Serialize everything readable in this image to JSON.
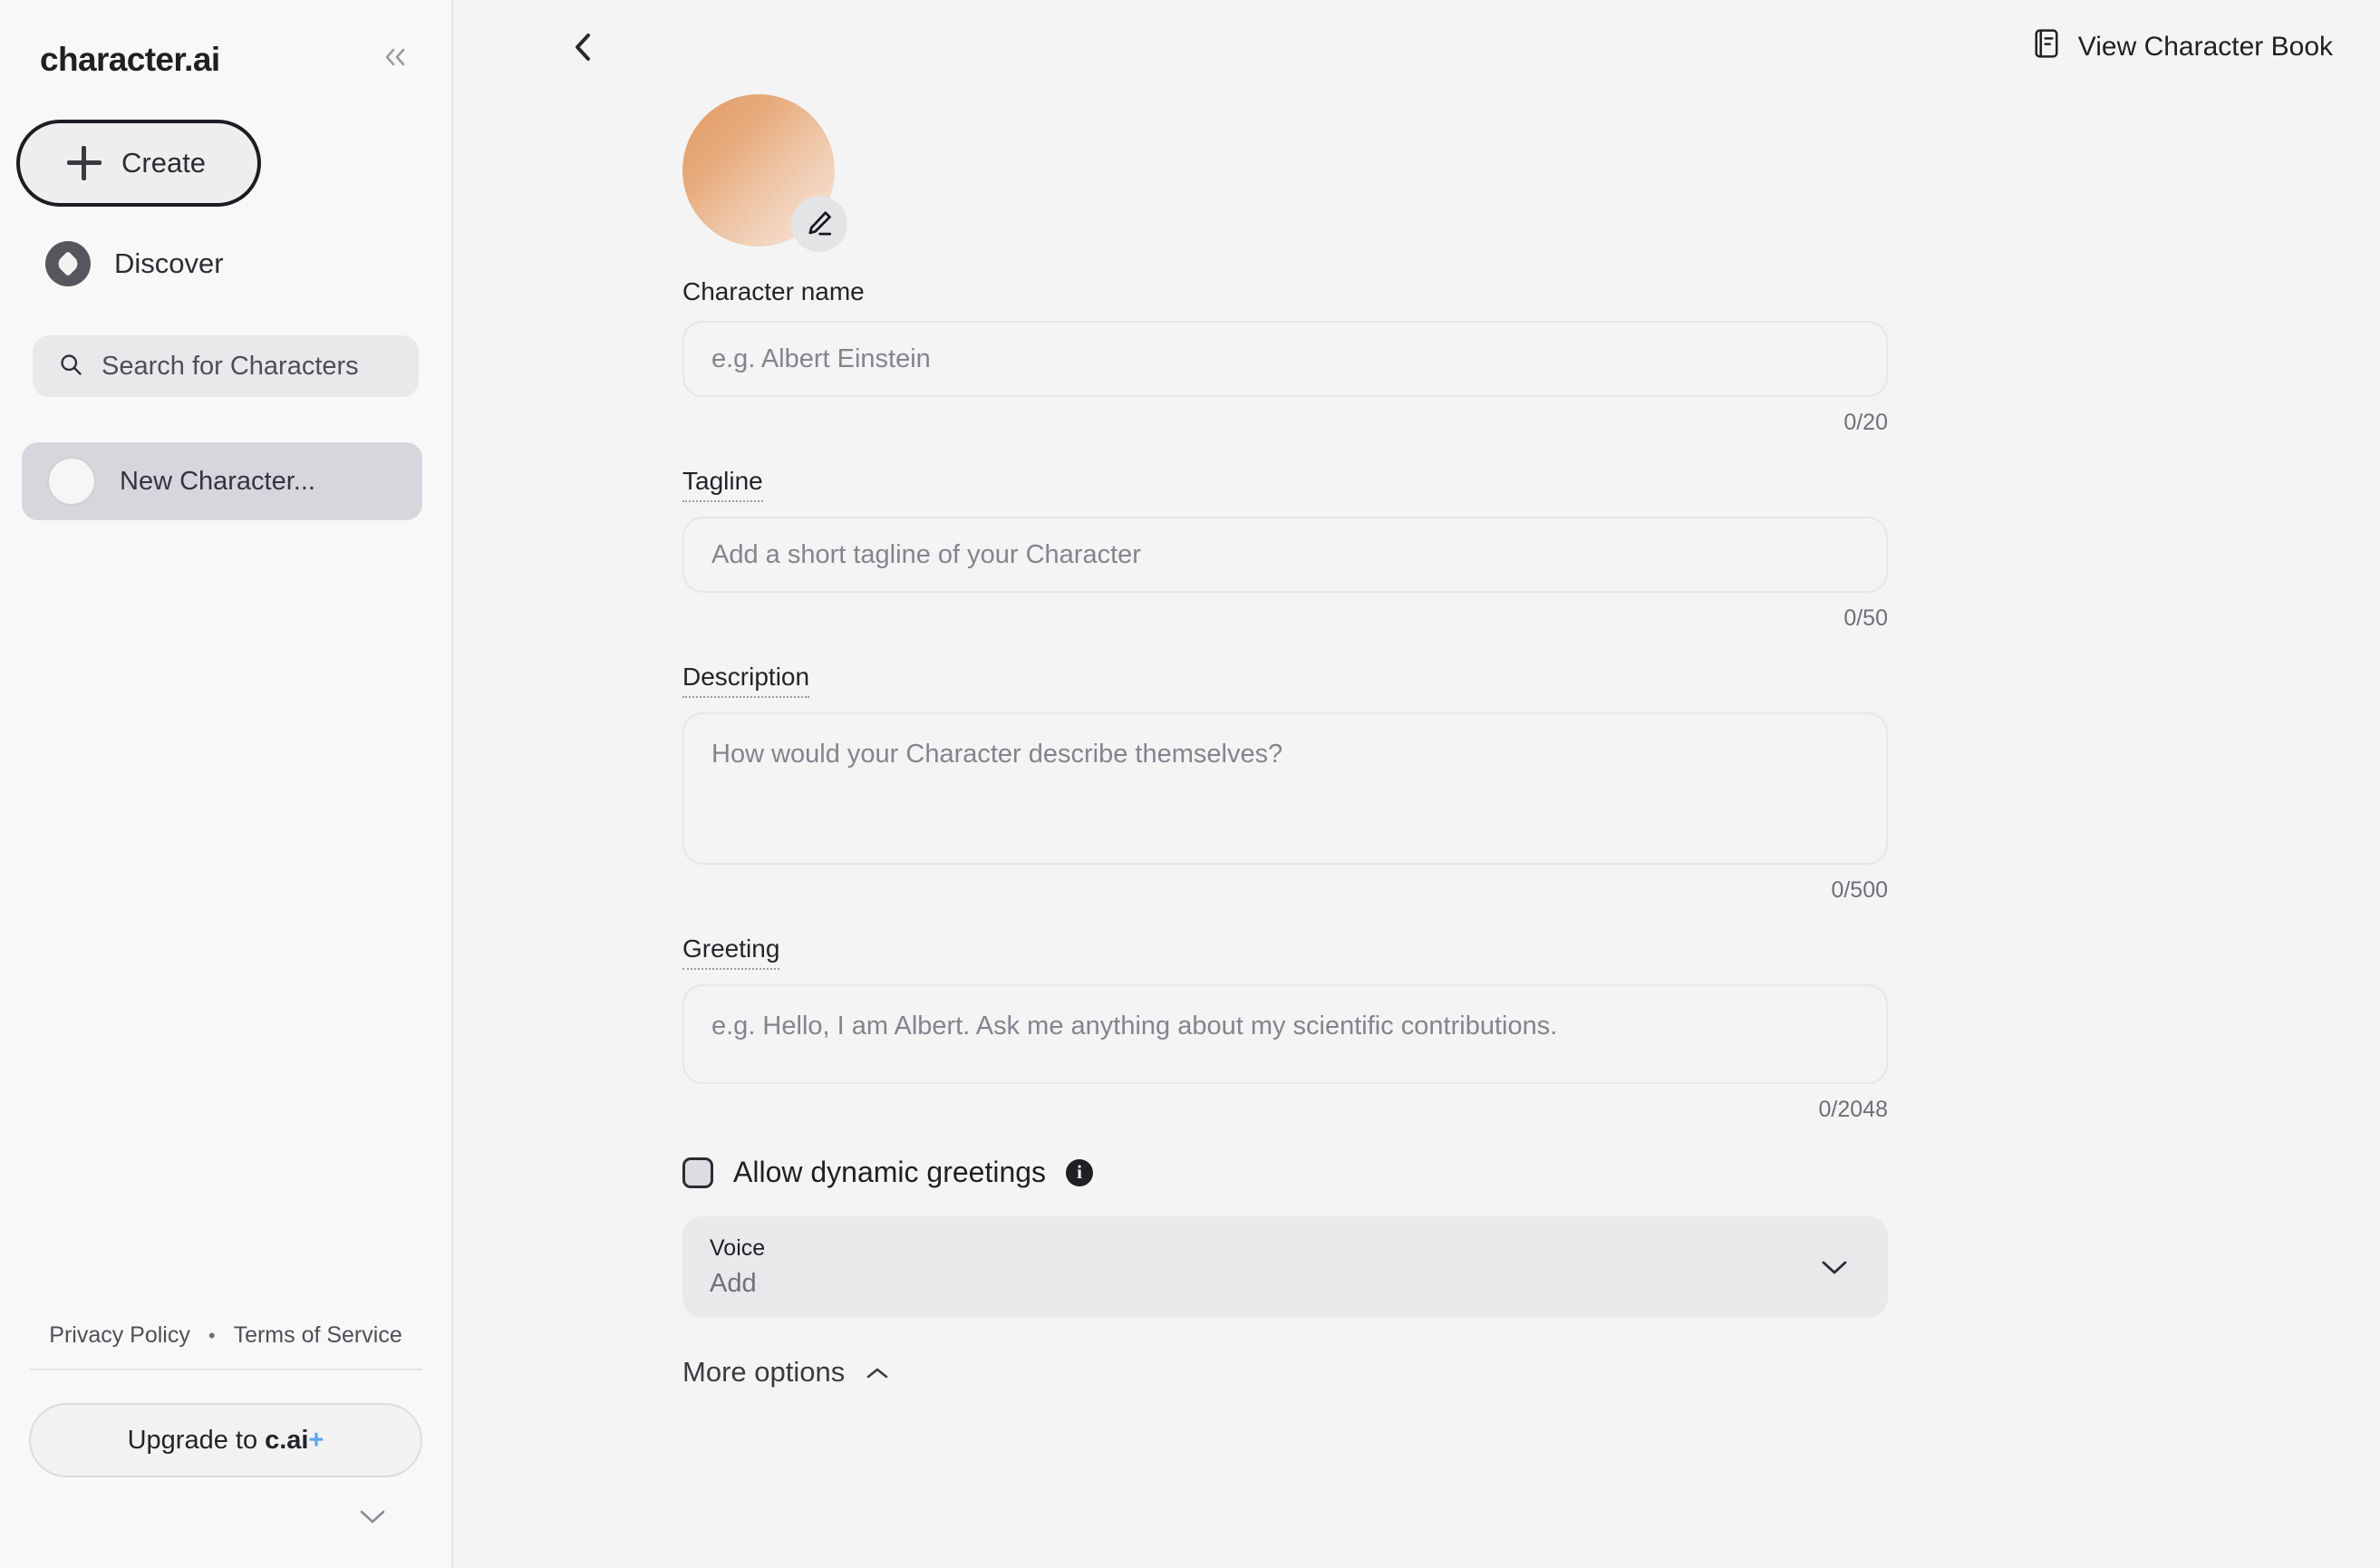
{
  "sidebar": {
    "brand": "character.ai",
    "collapse_label": "«",
    "create_label": "Create",
    "discover_label": "Discover",
    "search": {
      "placeholder": "Search for Characters"
    },
    "characters": [
      {
        "name": "New Character...",
        "selected": true
      }
    ],
    "footer": {
      "privacy_label": "Privacy Policy",
      "separator": "•",
      "terms_label": "Terms of Service",
      "upgrade_prefix": "Upgrade to",
      "upgrade_brand": "c.ai",
      "upgrade_plus": "+"
    }
  },
  "header": {
    "back_label": "",
    "character_book_label": "View Character Book"
  },
  "main": {
    "avatar": {
      "gradient_start": "#e09963",
      "gradient_end": "#f7e8dc",
      "edit_badge": "edit-pencil"
    },
    "fields": {
      "name": {
        "label": "Character name",
        "placeholder": "e.g. Albert Einstein",
        "value": "",
        "counter": "0/20"
      },
      "tagline": {
        "label": "Tagline",
        "placeholder": "Add a short tagline of your Character",
        "value": "",
        "counter": "0/50"
      },
      "description": {
        "label": "Description",
        "placeholder": "How would your Character describe themselves?",
        "value": "",
        "counter": "0/500"
      },
      "greeting": {
        "label": "Greeting",
        "placeholder": "e.g. Hello, I am Albert. Ask me anything about my scientific contributions.",
        "value": "",
        "counter": "0/2048"
      }
    },
    "dynamic_greetings": {
      "label": "Allow dynamic greetings",
      "checked": false,
      "info": "i"
    },
    "voice": {
      "label": "Voice",
      "value": "Add"
    },
    "more_options": {
      "label": "More options"
    }
  }
}
